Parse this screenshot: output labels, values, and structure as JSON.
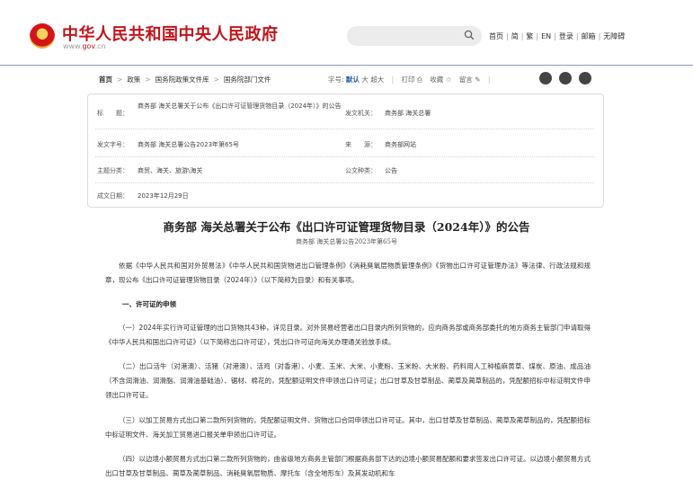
{
  "header": {
    "site_title": "中华人民共和国中央人民政府",
    "site_url_prefix": "www.",
    "site_url_brand": "gov",
    "site_url_suffix": ".cn",
    "search_placeholder": "",
    "links": [
      "首页",
      "简",
      "繁",
      "EN",
      "登录",
      "邮箱",
      "无障碍"
    ]
  },
  "breadcrumb": {
    "items": [
      "首页",
      "政策",
      "国务院政策文件库",
      "国务院部门文件"
    ]
  },
  "toolbar": {
    "font_label": "字号:",
    "font_default": "默认",
    "font_large": "大",
    "font_xlarge": "超大",
    "print_label": "打印",
    "favorite_label": "收藏",
    "comment_label": "留言"
  },
  "meta": {
    "title_label": "标　　题：",
    "title_value": "商务部 海关总署关于公布《出口许可证管理货物目录（2024年）》的公告",
    "issuer_label": "发文机关：",
    "issuer_value": "商务部 海关总署",
    "docno_label": "发文字号：",
    "docno_value": "商务部 海关总署公告2023年第65号",
    "source_label": "来　　源：",
    "source_value": "商务部网站",
    "topic_label": "主题分类：",
    "topic_value": "商贸、海关、旅游\\海关",
    "type_label": "公文种类：",
    "type_value": "公告",
    "date_label": "成文日期：",
    "date_value": "2023年12月29日"
  },
  "article": {
    "title": "商务部 海关总署关于公布《出口许可证管理货物目录（2024年）》的公告",
    "subtitle": "商务部 海关总署公告2023年第65号",
    "intro": "依据《中华人民共和国对外贸易法》《中华人民共和国货物进出口管理条例》《消耗臭氧层物质管理条例》《货物出口许可证管理办法》等法律、行政法规和规章，现公布《出口许可证管理货物目录（2024年）》（以下简称为目录）和有关事项。",
    "section1": "一、许可证的申领",
    "p1": "（一）2024年实行许可证管理的出口货物共43种，详见目录。对外贸易经营者出口目录内所列货物的，应向商务部或商务部委托的地方商务主管部门申请取得《中华人民共和国出口许可证》（以下简称出口许可证），凭出口许可证向海关办理通关验放手续。",
    "p2": "（二）出口活牛（对港澳）、活猪（对港澳）、活鸡（对香港）、小麦、玉米、大米、小麦粉、玉米粉、大米粉、药料用人工种植麻黄草、煤炭、原油、成品油（不含润滑油、润滑脂、润滑油基础油）、锯材、棉花的，凭配额证明文件申领出口许可证；出口甘草及甘草制品、蔺草及蔺草制品的，凭配额招标中标证明文件申领出口许可证。",
    "p3": "（三）以加工贸易方式出口第二款所列货物的，凭配额证明文件、货物出口合同申领出口许可证。其中，出口甘草及甘草制品、蔺草及蔺草制品的，凭配额招标中标证明文件、海关加工贸易进口报关单申领出口许可证。",
    "p4": "（四）以边境小额贸易方式出口第二款所列货物的，由省级地方商务主管部门根据商务部下达的边境小额贸易配额和要求签发出口许可证。以边境小额贸易方式出口甘草及甘草制品、蔺草及蔺草制品、消耗臭氧层物质、摩托车（含全地形车）及其发动机和车"
  },
  "colors": {
    "brand_red": "#c1141b",
    "link_blue": "#1a5aa6"
  },
  "icons": [
    "emblem-icon",
    "search-icon",
    "print-icon",
    "star-icon",
    "pencil-icon",
    "weibo-icon",
    "wechat-icon",
    "share-icon"
  ]
}
